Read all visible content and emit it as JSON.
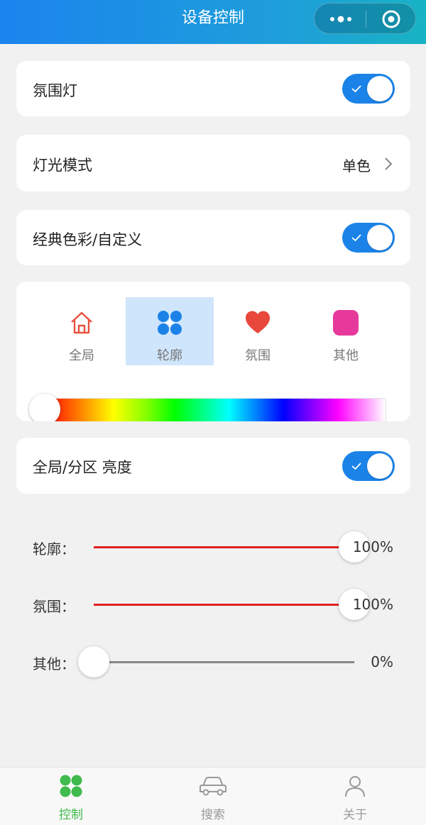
{
  "header": {
    "title": "设备控制"
  },
  "ambient_light": {
    "label": "氛围灯",
    "on": true
  },
  "light_mode": {
    "label": "灯光模式",
    "value": "单色"
  },
  "classic_colors": {
    "label": "经典色彩/自定义",
    "on": true
  },
  "zones": {
    "tabs": [
      {
        "label": "全局",
        "icon": "house-icon",
        "active": false,
        "color": "#e8523f"
      },
      {
        "label": "轮廓",
        "icon": "four-circles-icon",
        "active": true,
        "color": "#1b83e8"
      },
      {
        "label": "氛围",
        "icon": "heart-icon",
        "active": false,
        "color": "#e8473b"
      },
      {
        "label": "其他",
        "icon": "rounded-square-icon",
        "active": false,
        "color": "#e6399b"
      }
    ],
    "hue_position": 0
  },
  "brightness_mode": {
    "label": "全局/分区 亮度",
    "on": true
  },
  "brightness": [
    {
      "label": "轮廓：",
      "value": 100,
      "value_text": "100%"
    },
    {
      "label": "氛围：",
      "value": 100,
      "value_text": "100%"
    },
    {
      "label": "其他：",
      "value": 0,
      "value_text": "0%"
    }
  ],
  "tabbar": {
    "items": [
      {
        "label": "控制",
        "icon": "four-circles-icon",
        "active": true
      },
      {
        "label": "搜索",
        "icon": "car-icon",
        "active": false
      },
      {
        "label": "关于",
        "icon": "person-icon",
        "active": false
      }
    ]
  },
  "colors": {
    "primary": "#1b83e8",
    "slider_active": "#e02020",
    "tabbar_active": "#3fba4d",
    "tabbar_inactive": "#999999"
  }
}
